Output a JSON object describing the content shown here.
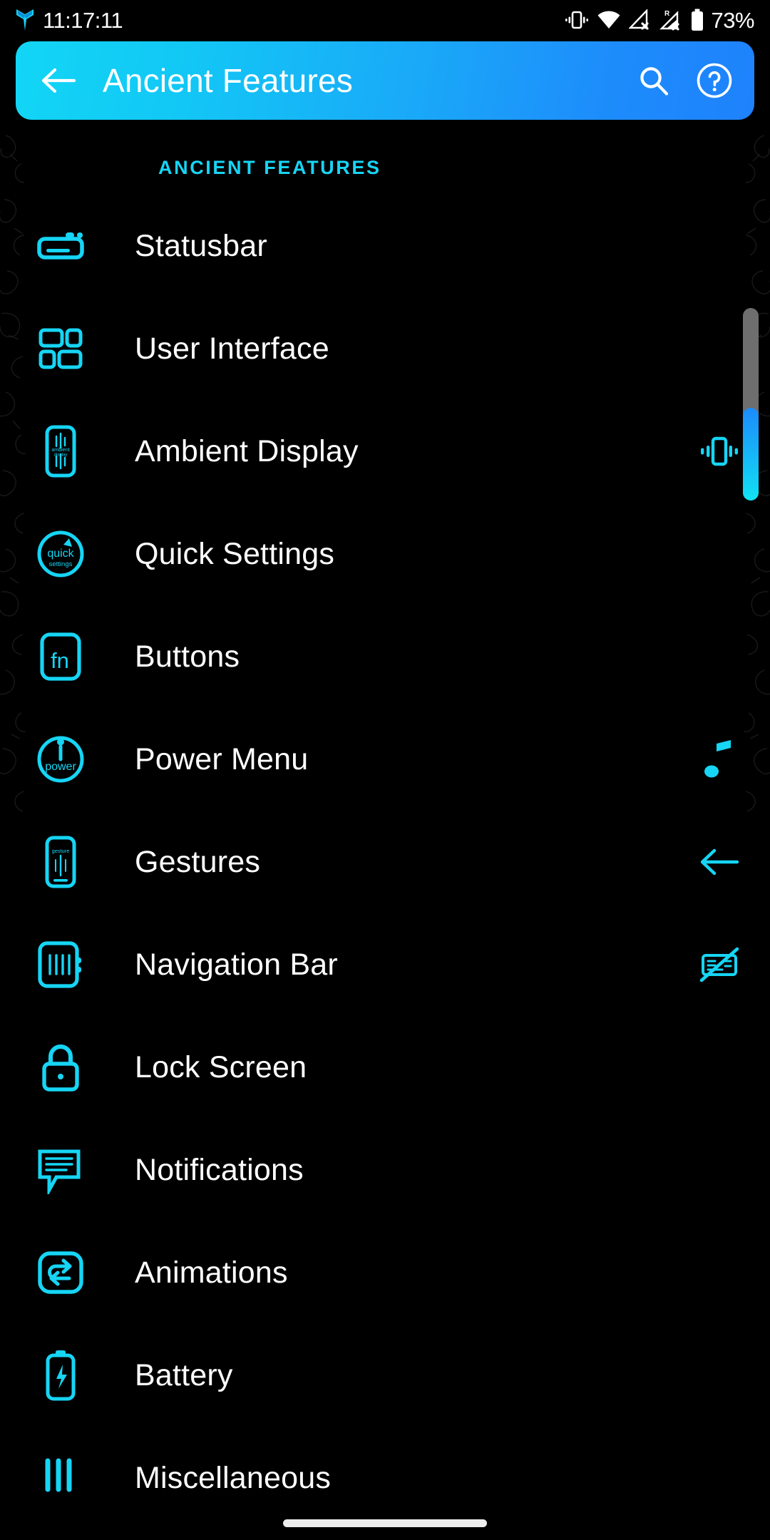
{
  "statusbar": {
    "clock": "11:17:11",
    "battery_percent": "73%",
    "logo_icon": "app-logo-icon",
    "icons": [
      "vibrate-icon",
      "wifi-icon",
      "signal-no-service-icon",
      "roaming-signal-no-service-icon",
      "battery-icon"
    ],
    "roaming_label": "R"
  },
  "appbar": {
    "title": "Ancient Features",
    "back_icon": "back-arrow-icon",
    "search_icon": "search-icon",
    "help_icon": "help-circle-icon"
  },
  "section": {
    "label": "ANCIENT FEATURES"
  },
  "colors": {
    "accent_cyan": "#16D5F5",
    "accent_blue": "#1E82FC",
    "background": "#000000",
    "text": "#FFFFFF",
    "scroll_track": "#6E6E6E"
  },
  "items": [
    {
      "label": "Statusbar",
      "icon": "statusbar-icon",
      "accessory": null
    },
    {
      "label": "User Interface",
      "icon": "user-interface-icon",
      "accessory": null
    },
    {
      "label": "Ambient Display",
      "icon": "ambient-display-icon",
      "accessory": "vibrate-icon",
      "icon_text": "ambient display"
    },
    {
      "label": "Quick Settings",
      "icon": "quick-settings-icon",
      "accessory": null,
      "icon_text": "quick",
      "icon_subtext": "settings"
    },
    {
      "label": "Buttons",
      "icon": "buttons-fn-key-icon",
      "accessory": null,
      "icon_text": "fn"
    },
    {
      "label": "Power Menu",
      "icon": "power-menu-icon",
      "accessory": "music-note-icon",
      "icon_text": "power"
    },
    {
      "label": "Gestures",
      "icon": "gestures-icon",
      "accessory": "back-arrow-icon",
      "icon_text": "gesture"
    },
    {
      "label": "Navigation Bar",
      "icon": "navigation-bar-icon",
      "accessory": "hide-keyboard-icon"
    },
    {
      "label": "Lock Screen",
      "icon": "lock-icon",
      "accessory": null
    },
    {
      "label": "Notifications",
      "icon": "notification-bubble-icon",
      "accessory": null
    },
    {
      "label": "Animations",
      "icon": "animations-icon",
      "accessory": null
    },
    {
      "label": "Battery",
      "icon": "battery-bolt-icon",
      "accessory": null
    },
    {
      "label": "Miscellaneous",
      "icon": "miscellaneous-icon",
      "accessory": null
    }
  ],
  "scrollbar": {
    "name": "vertical-scrollbar"
  },
  "navigation": {
    "gesture_pill": "home-gesture-pill"
  }
}
